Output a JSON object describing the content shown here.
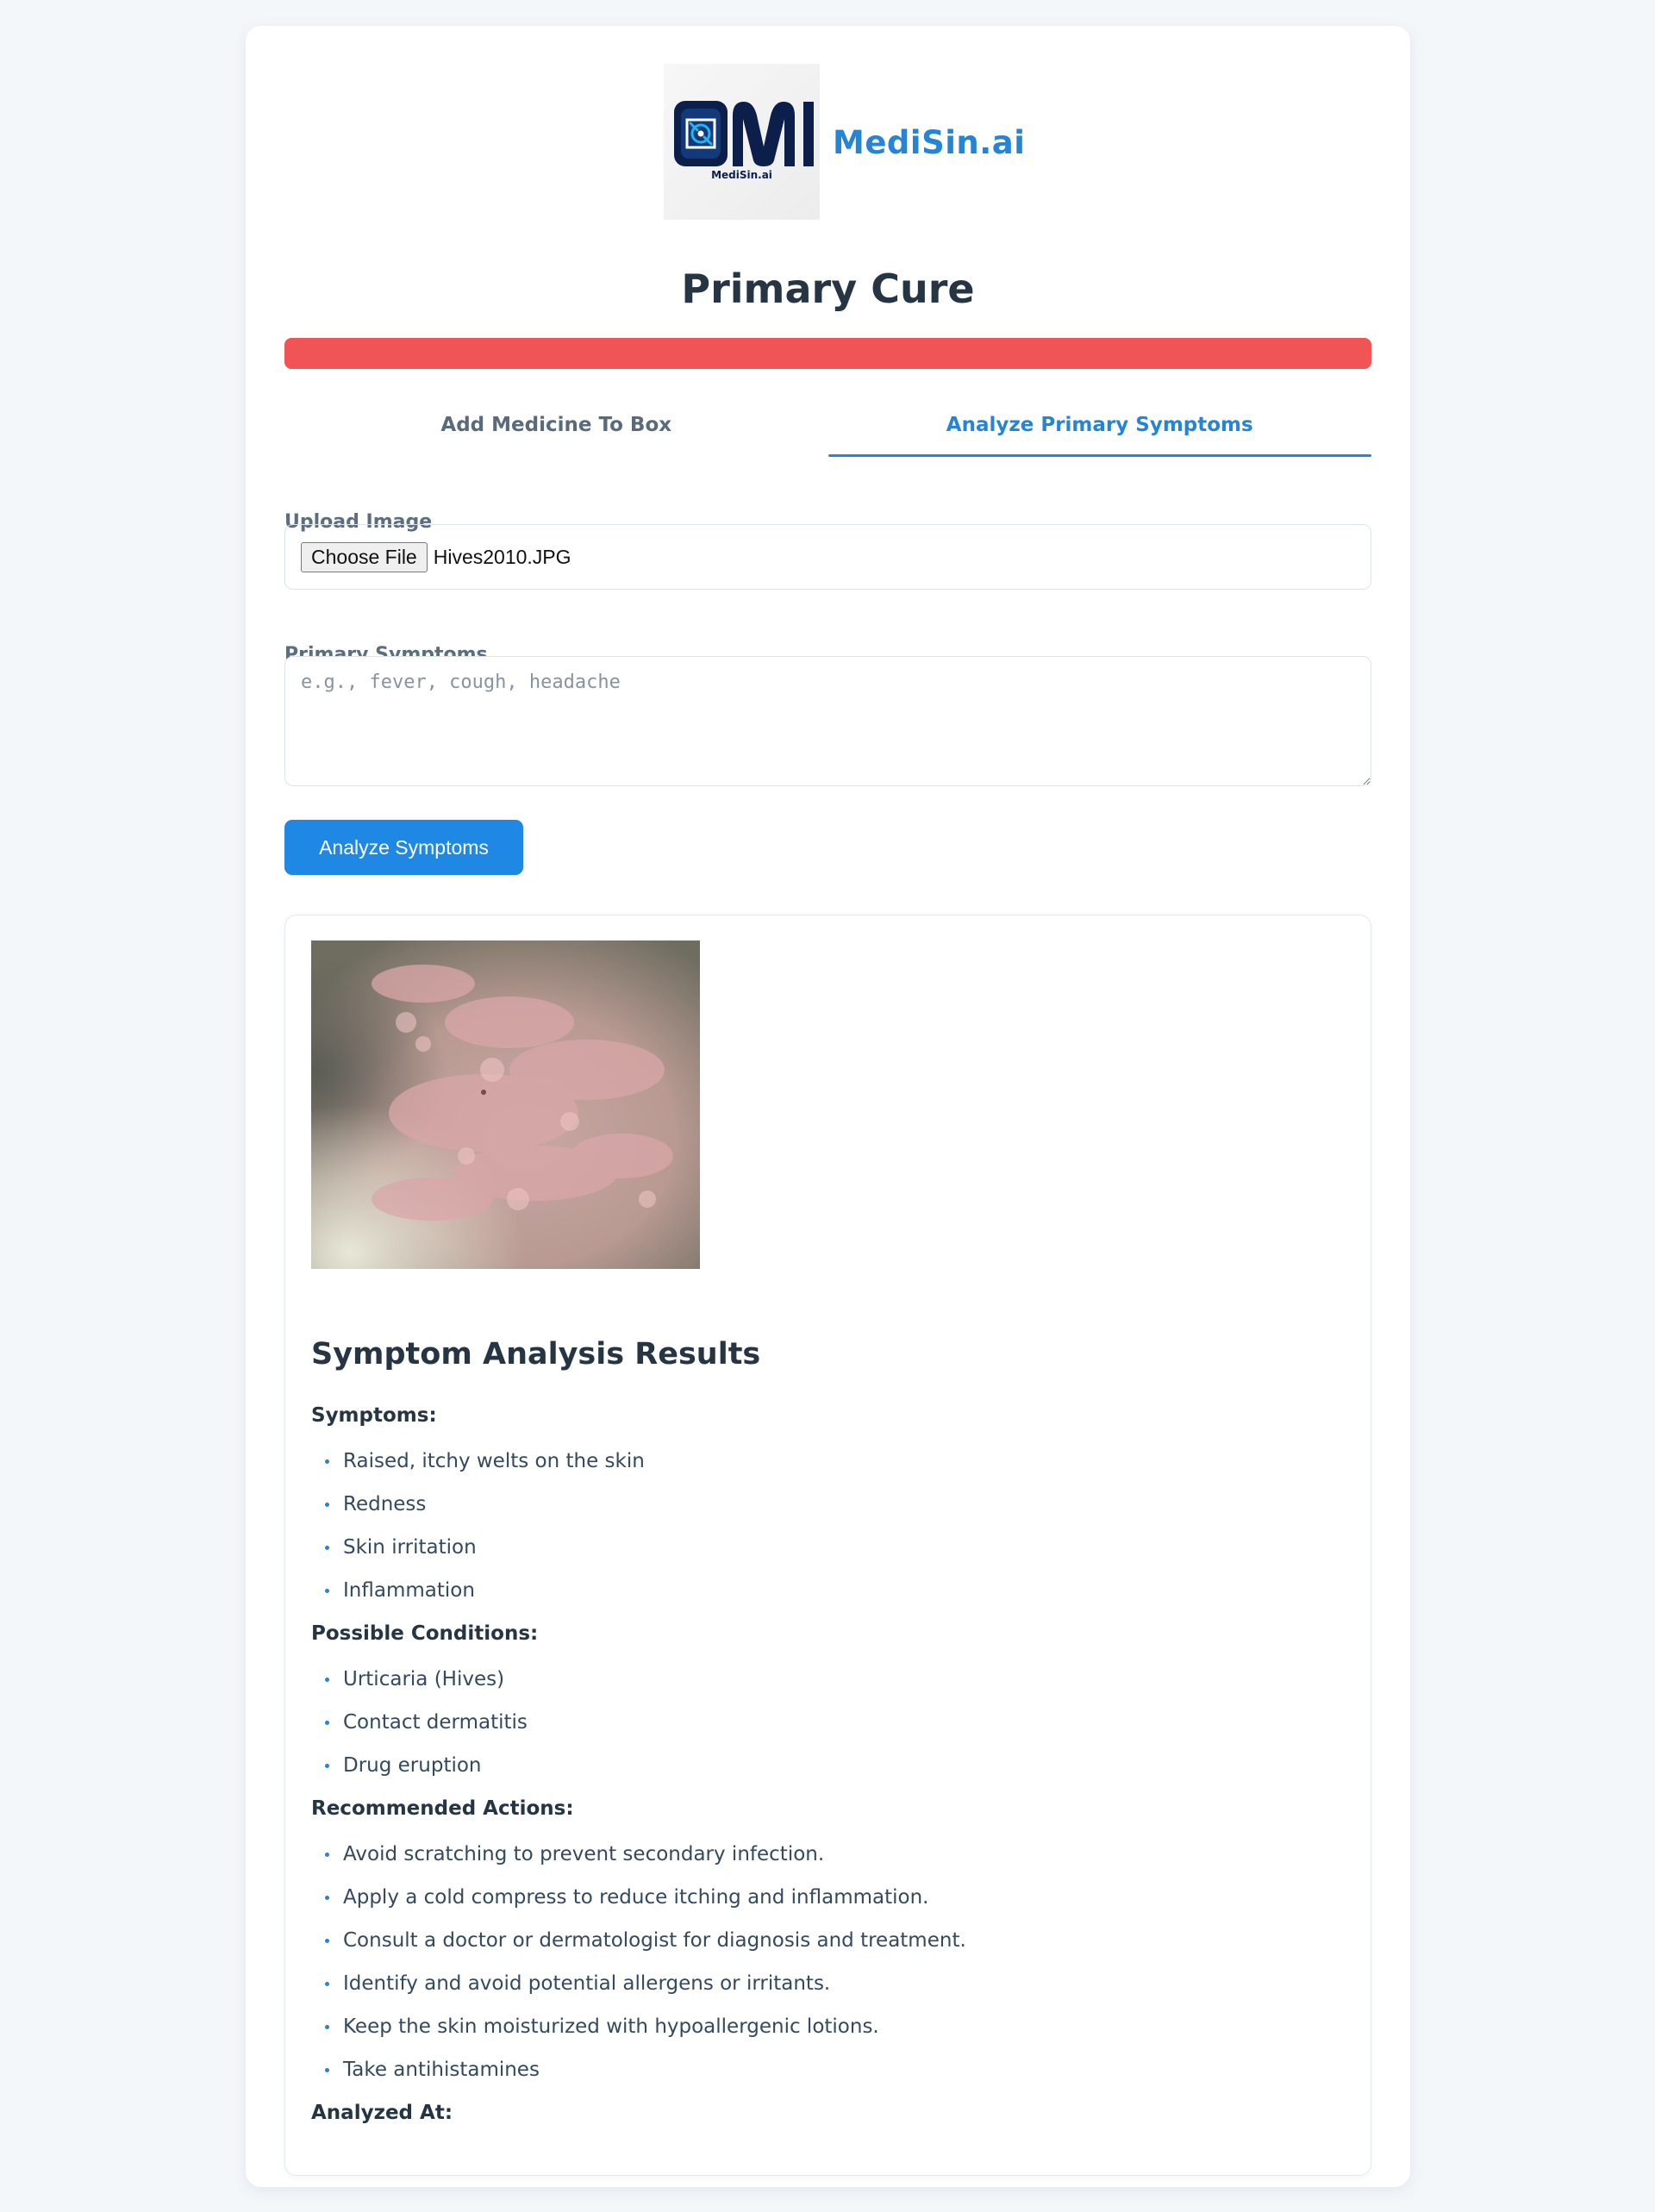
{
  "brand": {
    "name": "MediSin.ai",
    "logo_caption": "MediSin.ai"
  },
  "page_title": "Primary Cure",
  "tabs": [
    {
      "label": "Add Medicine To Box",
      "active": false
    },
    {
      "label": "Analyze Primary Symptoms",
      "active": true
    }
  ],
  "form": {
    "upload_label": "Upload Image",
    "choose_file_label": "Choose File",
    "file_name": "Hives2010.JPG",
    "symptoms_label": "Primary Symptoms",
    "symptoms_value": "",
    "symptoms_placeholder": "e.g., fever, cough, headache",
    "analyze_button": "Analyze Symptoms"
  },
  "results": {
    "title": "Symptom Analysis Results",
    "symptoms_heading": "Symptoms:",
    "symptoms": [
      "Raised, itchy welts on the skin",
      "Redness",
      "Skin irritation",
      "Inflammation"
    ],
    "conditions_heading": "Possible Conditions:",
    "conditions": [
      "Urticaria (Hives)",
      "Contact dermatitis",
      "Drug eruption"
    ],
    "actions_heading": "Recommended Actions:",
    "actions": [
      "Avoid scratching to prevent secondary infection.",
      "Apply a cold compress to reduce itching and inflammation.",
      "Consult a doctor or dermatologist for diagnosis and treatment.",
      "Identify and avoid potential allergens or irritants.",
      "Keep the skin moisturized with hypoallergenic lotions.",
      "Take antihistamines"
    ],
    "analyzed_at_label": "Analyzed At:"
  },
  "colors": {
    "accent": "#1f88e5",
    "brand": "#2484d6",
    "alert": "#f05455",
    "page_bg": "#f4f7fa"
  }
}
